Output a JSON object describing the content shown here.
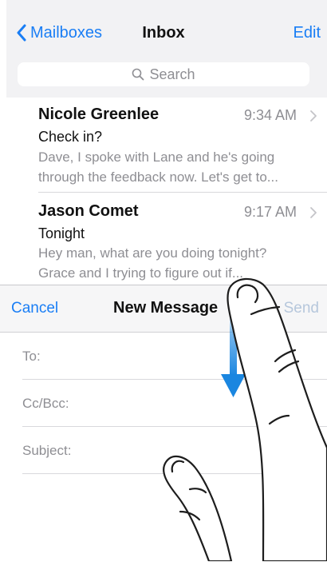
{
  "inbox": {
    "back_label": "Mailboxes",
    "title": "Inbox",
    "edit_label": "Edit",
    "search_placeholder": "Search",
    "messages": [
      {
        "sender": "Nicole Greenlee",
        "time": "9:34 AM",
        "subject": "Check in?",
        "preview_lines": [
          "Dave, I spoke with Lane and he's going",
          "through the feedback now. Let's get to..."
        ]
      },
      {
        "sender": "Jason Comet",
        "time": "9:17 AM",
        "subject": "Tonight",
        "preview_lines": [
          "Hey man, what are you doing tonight?",
          "Grace and I trying to figure out if..."
        ]
      }
    ]
  },
  "compose": {
    "cancel_label": "Cancel",
    "title": "New Message",
    "send_label": "Send",
    "fields": [
      "To:",
      "Cc/Bcc:",
      "Subject:"
    ]
  },
  "gesture": {
    "icon": "swipe-down-hand-icon",
    "arrow_color": "#1a86e0"
  },
  "colors": {
    "accent": "#1a7ef5",
    "secondary_text": "#8e8e93",
    "nav_background": "#f2f2f4"
  }
}
